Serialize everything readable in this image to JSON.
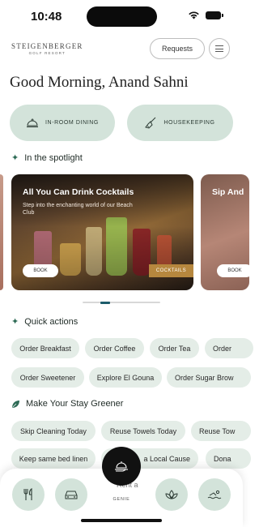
{
  "status_bar": {
    "time": "10:48"
  },
  "brand": {
    "name": "STEIGENBERGER",
    "sub": "GOLF RESORT"
  },
  "header": {
    "requests_label": "Requests"
  },
  "greeting": "Good Morning, Anand Sahni",
  "main_buttons": [
    {
      "label": "IN-ROOM DINING",
      "icon": "cloche-icon"
    },
    {
      "label": "HOUSEKEEPING",
      "icon": "broom-icon"
    }
  ],
  "spotlight": {
    "title": "In the spotlight",
    "cards": [
      {
        "title": "All You Can Drink Cocktails",
        "description": "Step into the enchanting world of our Beach Club",
        "button": "BOOK",
        "tag": "COCKTAILS"
      },
      {
        "title": "Sip And",
        "button": "BOOK"
      }
    ],
    "active_page": 1
  },
  "quick_actions": {
    "title": "Quick actions",
    "row1": [
      "Order Breakfast",
      "Order Coffee",
      "Order Tea",
      "Order"
    ],
    "row2": [
      "Order Sweetener",
      "Explore El Gouna",
      "Order Sugar Brow"
    ]
  },
  "greener": {
    "title": "Make Your Stay Greener",
    "row1": [
      "Skip Cleaning Today",
      "Reuse Towels Today",
      "Reuse Tow"
    ],
    "row2": [
      "Keep same bed linen",
      "a Local Cause",
      "Dona"
    ],
    "overlap_text": "Rent a"
  },
  "bottom_nav": {
    "genie_label": "GENIE",
    "icons": [
      "dining-icon",
      "car-icon",
      "lotus-icon",
      "swim-icon"
    ]
  },
  "colors": {
    "accent_green": "#d3e3da",
    "chip_bg": "#e4ede7",
    "tag_gold": "#b6873e",
    "pager_active": "#1d5c6b"
  }
}
